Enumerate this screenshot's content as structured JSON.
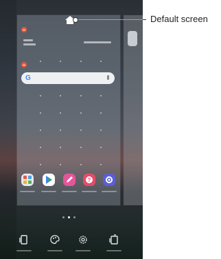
{
  "callout": {
    "label": "Default screen"
  },
  "icons": {
    "home": "home-icon",
    "google": "G",
    "toolbar": [
      "widgets-icon",
      "wallpaper-icon",
      "settings-icon",
      "apps-screen-icon"
    ]
  },
  "apps": [
    {
      "name": "folder-app",
      "color": "#e7e9ec"
    },
    {
      "name": "play-store-app",
      "color": "#ffffff"
    },
    {
      "name": "note-app",
      "color": "#e4569b"
    },
    {
      "name": "help-app",
      "color": "#e54b6a"
    },
    {
      "name": "settings-app",
      "color": "#5a5fd6"
    }
  ],
  "colors": {
    "remove_badge": "#e75a3c",
    "search_bar": "#eef0f2",
    "google_blue": "#4285f4"
  }
}
